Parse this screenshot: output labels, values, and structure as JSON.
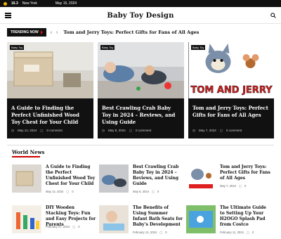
{
  "topbar": {
    "weather_temp": "16.3",
    "city": "New York",
    "date": "May 15, 2024"
  },
  "header": {
    "site_title": "Baby Toy Design"
  },
  "trending": {
    "label": "TRENDING NOW",
    "arrows": "‹ ›",
    "headline": "Tom and Jerry Toys: Perfect Gifts for Fans of All Ages"
  },
  "featured": [
    {
      "tag": "Baby Toy",
      "title": "A Guide to Finding the Perfect Unfinished Wood Toy Chest for Your Child",
      "date": "May 14, 2024",
      "comments": "0 comment"
    },
    {
      "tag": "Baby Toy",
      "title": "Best Crawling Crab Baby Toy in 2024 – Reviews, and Using Guide",
      "date": "May 8, 2024",
      "comments": "0 comment"
    },
    {
      "tag": "Baby Toy",
      "title": "Tom and Jerry Toys: Perfect Gifts for Fans of All Ages",
      "date": "May 7, 2024",
      "comments": "0 comment"
    }
  ],
  "world_news": {
    "title": "World News",
    "items": [
      {
        "title": "A Guide to Finding the Perfect Unfinished Wood Toy Chest for Your Child",
        "date": "May 14, 2024",
        "comments": "0"
      },
      {
        "title": "Best Crawling Crab Baby Toy in 2024 – Reviews, and Using Guide",
        "date": "May 8, 2024",
        "comments": "0"
      },
      {
        "title": "Tom and Jerry Toys: Perfect Gifts for Fans of All Ages",
        "date": "May 7, 2024",
        "comments": "0"
      },
      {
        "title": "DIY Wooden Stacking Toys: Fun and Easy Projects for Parents",
        "date": "February 27, 2024",
        "comments": "0"
      },
      {
        "title": "The Benefits of Using Summer Infant Bath Seats for Baby's Development",
        "date": "February 12, 2024",
        "comments": "0"
      },
      {
        "title": "The Ultimate Guide to Setting Up Your H2OGO Splash Pad from Costco",
        "date": "February 11, 2024",
        "comments": "0"
      }
    ]
  }
}
